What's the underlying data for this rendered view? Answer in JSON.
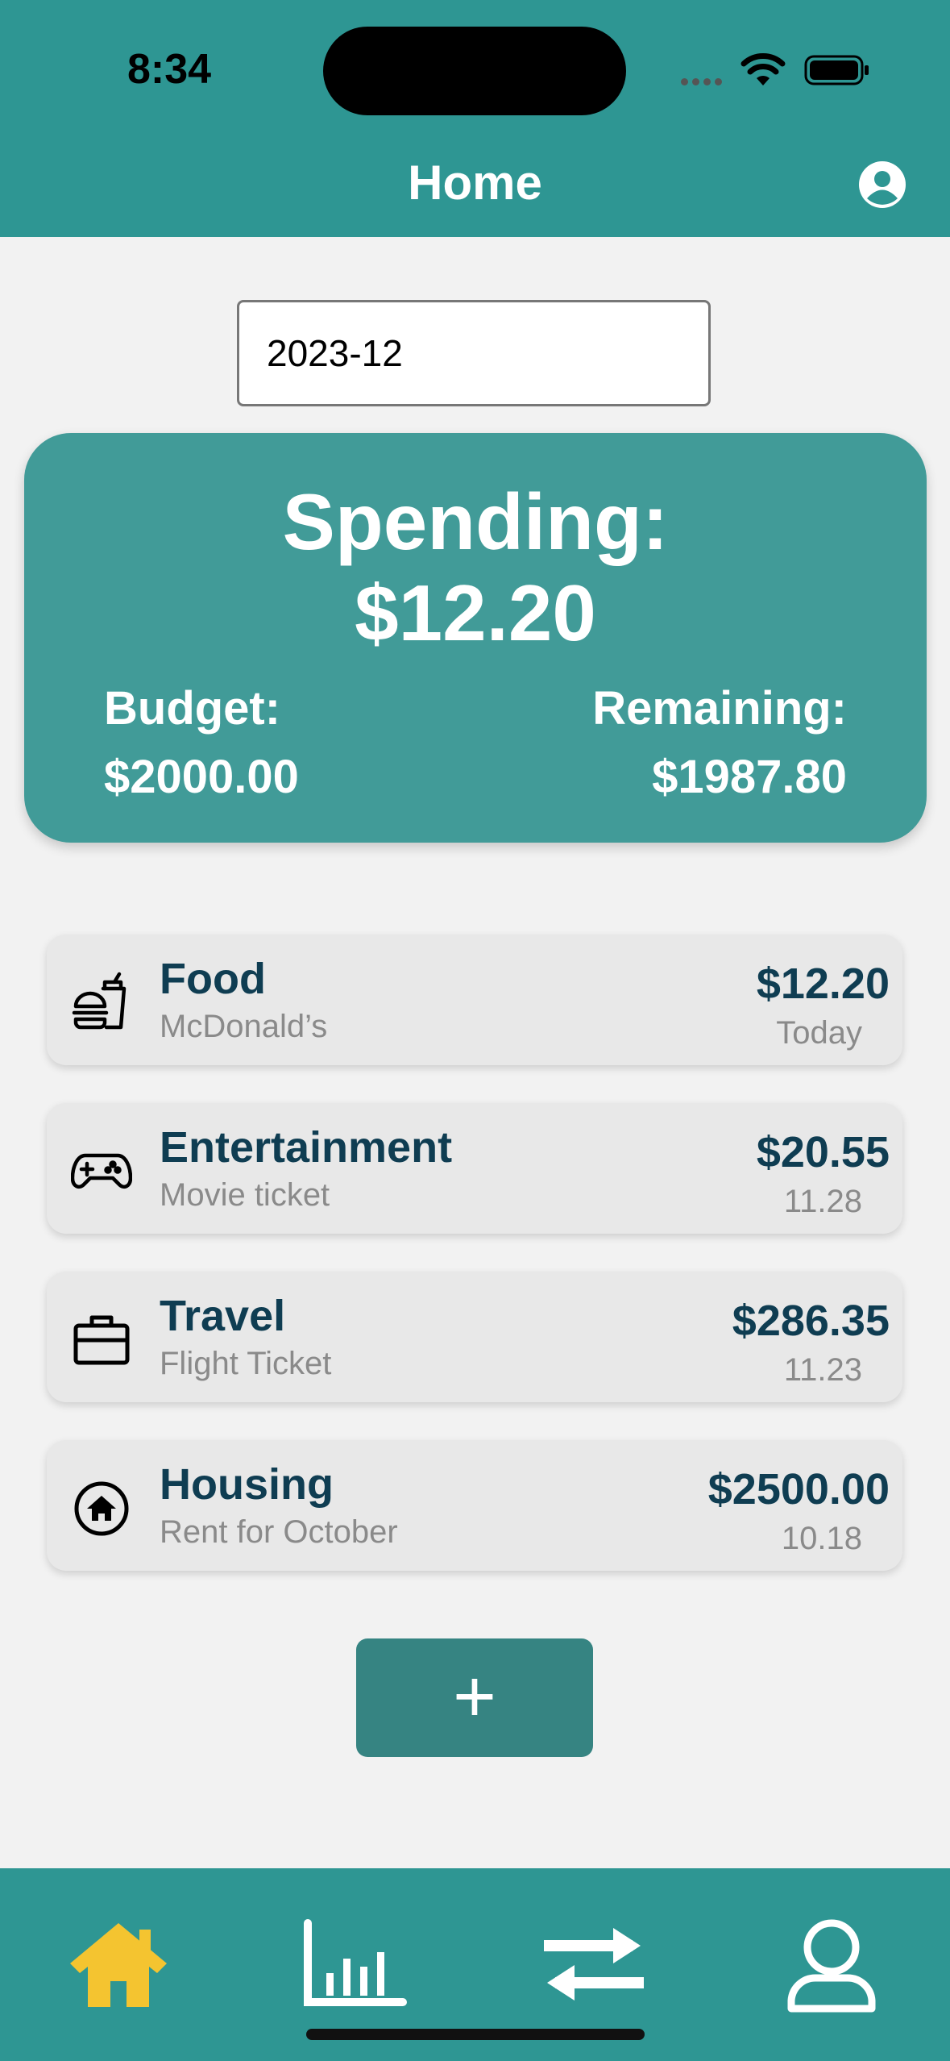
{
  "status": {
    "time": "8:34"
  },
  "header": {
    "title": "Home"
  },
  "month": {
    "value": "2023-12"
  },
  "summary": {
    "spending_label": "Spending:",
    "spending_value": "$12.20",
    "budget_label": "Budget:",
    "budget_value": "$2000.00",
    "remaining_label": "Remaining:",
    "remaining_value": "$1987.80"
  },
  "transactions": [
    {
      "icon": "food-icon",
      "category": "Food",
      "description": "McDonald’s",
      "amount": "$12.20",
      "date": "Today"
    },
    {
      "icon": "gamepad-icon",
      "category": "Entertainment",
      "description": "Movie ticket",
      "amount": "$20.55",
      "date": "11.28"
    },
    {
      "icon": "briefcase-icon",
      "category": "Travel",
      "description": "Flight Ticket",
      "amount": "$286.35",
      "date": "11.23"
    },
    {
      "icon": "house-icon",
      "category": "Housing",
      "description": "Rent for October",
      "amount": "$2500.00",
      "date": "10.18"
    }
  ],
  "add_button": {
    "label": "+"
  },
  "tabs": [
    {
      "name": "home-icon",
      "active": true
    },
    {
      "name": "chart-icon",
      "active": false
    },
    {
      "name": "transfer-icon",
      "active": false
    },
    {
      "name": "profile-icon",
      "active": false
    }
  ],
  "colors": {
    "teal": "#2e9693",
    "card_teal": "#419b98",
    "accent_yellow": "#f4c430",
    "dark_text": "#0f3d52"
  }
}
